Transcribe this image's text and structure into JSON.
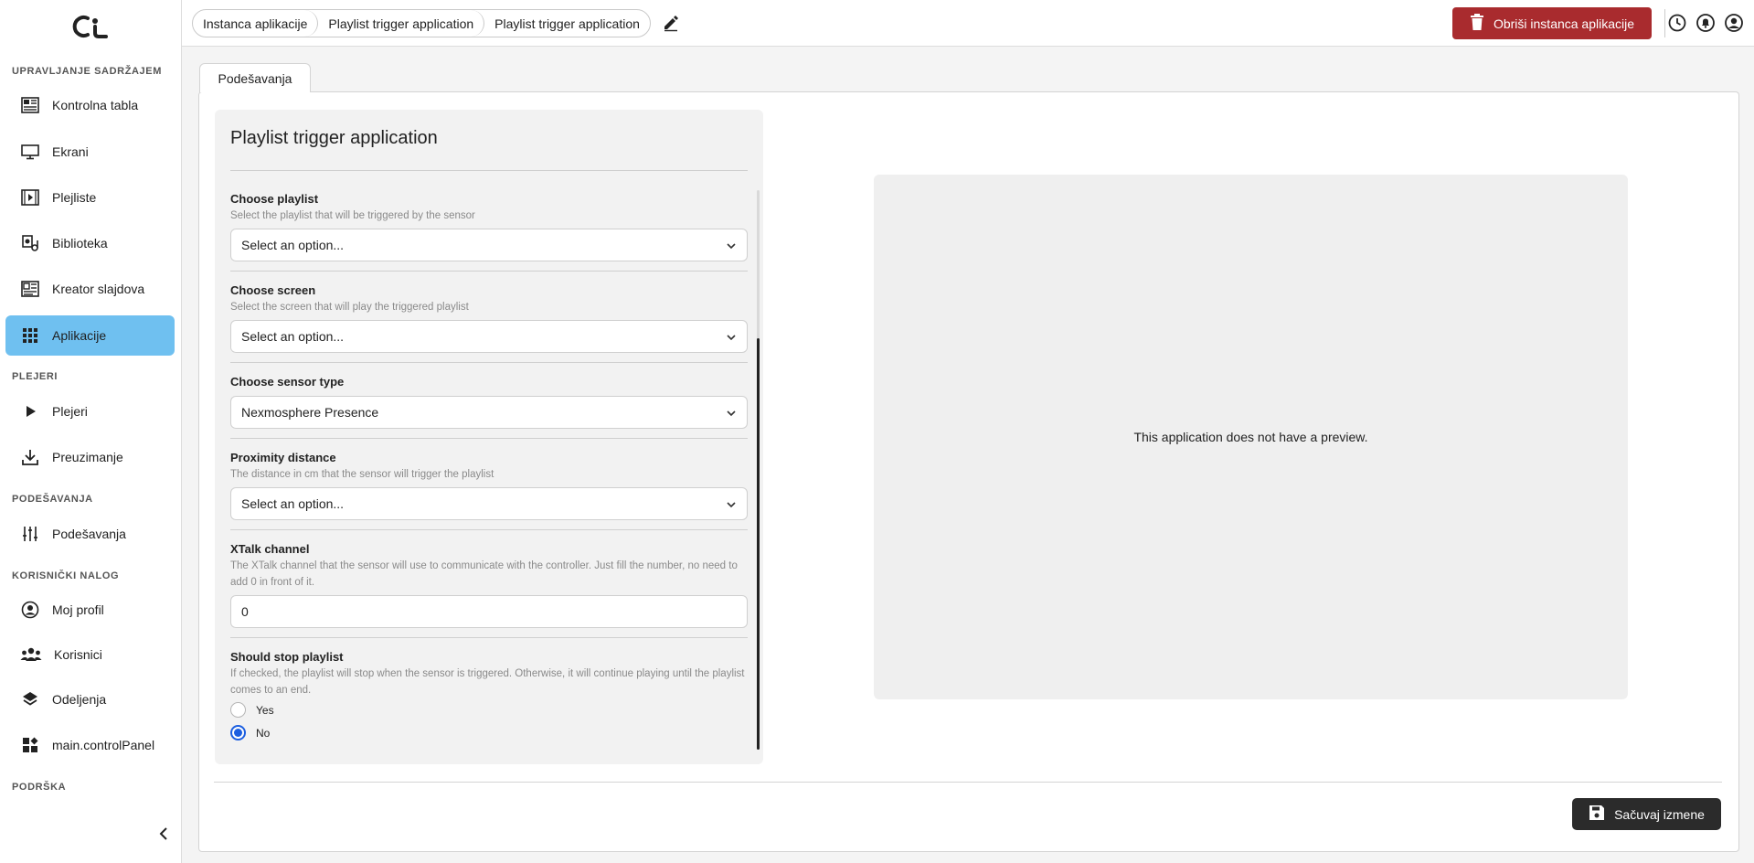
{
  "sidebar": {
    "logo": "ci-logo",
    "sections": [
      {
        "label": "UPRAVLJANJE SADRŽAJEM"
      },
      {
        "label": "PLEJERI"
      },
      {
        "label": "PODEŠAVANJA"
      },
      {
        "label": "KORISNIČKI NALOG"
      },
      {
        "label": "PODRŠKA"
      }
    ],
    "items": [
      {
        "label": "Kontrolna tabla",
        "icon": "dashboard-icon"
      },
      {
        "label": "Ekrani",
        "icon": "monitor-icon"
      },
      {
        "label": "Plejliste",
        "icon": "playlist-icon"
      },
      {
        "label": "Biblioteka",
        "icon": "library-icon"
      },
      {
        "label": "Kreator slajdova",
        "icon": "slide-creator-icon"
      },
      {
        "label": "Aplikacije",
        "icon": "apps-grid-icon",
        "active": true
      },
      {
        "label": "Plejeri",
        "icon": "play-icon"
      },
      {
        "label": "Preuzimanje",
        "icon": "download-icon"
      },
      {
        "label": "Podešavanja",
        "icon": "sliders-icon"
      },
      {
        "label": "Moj profil",
        "icon": "profile-icon"
      },
      {
        "label": "Korisnici",
        "icon": "users-icon"
      },
      {
        "label": "Odeljenja",
        "icon": "layers-icon"
      },
      {
        "label": "main.controlPanel",
        "icon": "widgets-icon"
      }
    ],
    "active_color": "#6fc0f0"
  },
  "header": {
    "breadcrumbs": [
      "Instanca aplikacije",
      "Playlist trigger application",
      "Playlist trigger application"
    ],
    "delete_label": "Obriši instanca aplikacije",
    "delete_color": "#a92b2e"
  },
  "main": {
    "tab_label": "Podešavanja",
    "form": {
      "title": "Playlist trigger application",
      "fields": [
        {
          "label": "Choose playlist",
          "help": "Select the playlist that will be triggered by the sensor",
          "value": "Select an option..."
        },
        {
          "label": "Choose screen",
          "help": "Select the screen that will play the triggered playlist",
          "value": "Select an option..."
        },
        {
          "label": "Choose sensor type",
          "help": "",
          "value": "Nexmosphere Presence"
        },
        {
          "label": "Proximity distance",
          "help": "The distance in cm that the sensor will trigger the playlist",
          "value": "Select an option..."
        },
        {
          "label": "XTalk channel",
          "help": "The XTalk channel that the sensor will use to communicate with the controller. Just fill the number, no need to add 0 in front of it.",
          "value": "0"
        },
        {
          "label": "Should stop playlist",
          "help": "If checked, the playlist will stop when the sensor is triggered. Otherwise, it will continue playing until the playlist comes to an end.",
          "options": [
            "Yes",
            "No"
          ],
          "selected": "No"
        }
      ]
    },
    "preview_text": "This application does not have a preview.",
    "save_label": "Sačuvaj izmene"
  }
}
